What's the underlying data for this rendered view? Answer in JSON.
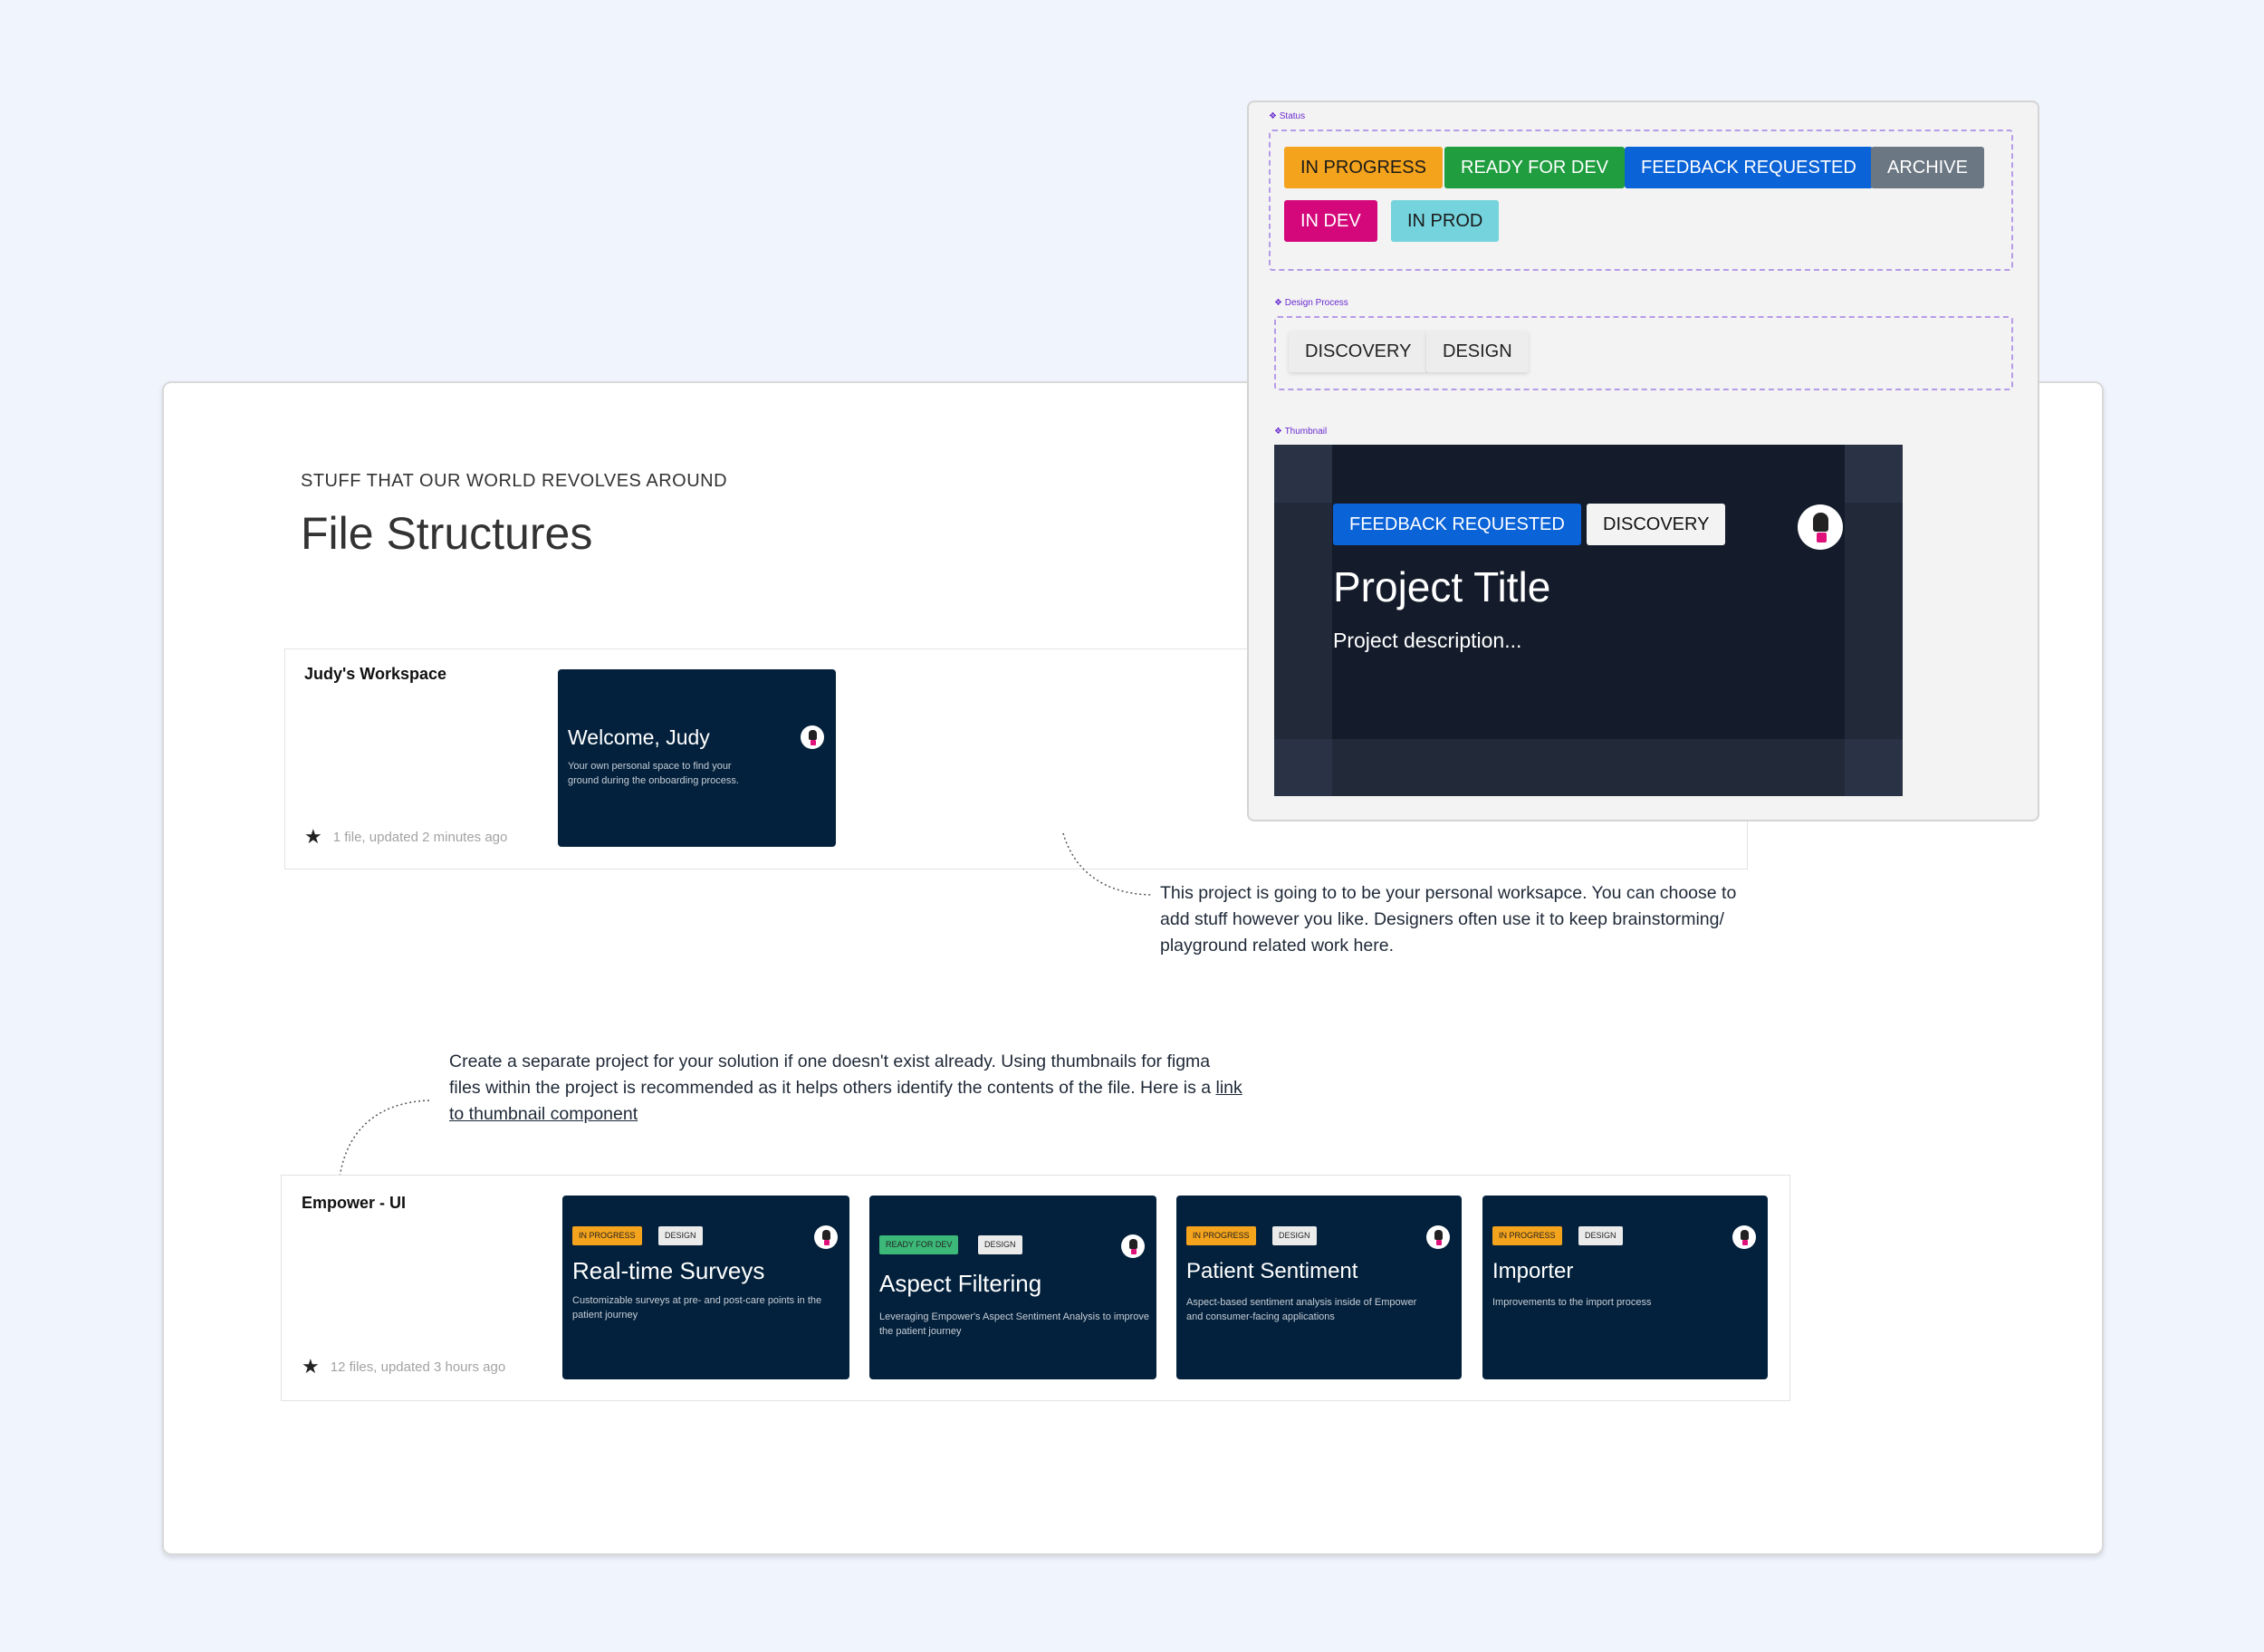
{
  "header": {
    "eyebrow": "STUFF THAT OUR WORLD REVOLVES AROUND",
    "title": "File Structures"
  },
  "workspace": {
    "name": "Judy's Workspace",
    "meta": "1 file, updated 2 minutes ago",
    "thumbnail": {
      "title": "Welcome, Judy",
      "description": "Your own personal space to find your ground during the onboarding process."
    }
  },
  "workspace_note": "This project is going to to be your personal worksapce. You can choose to add stuff however you like. Designers often use it to keep brainstorming/ playground related work here.",
  "solution_note": {
    "text": "Create a separate project for your solution if one doesn't exist already. Using thumbnails for figma files within the project is recommended as it helps others identify the contents of the file. Here is a",
    "link": "link to thumbnail component"
  },
  "project": {
    "name": "Empower - UI",
    "meta": "12 files, updated 3 hours ago",
    "files": [
      {
        "status": "IN PROGRESS",
        "status_color": "#f4a31c",
        "process": "DESIGN",
        "title": "Real-time Surveys",
        "description": "Customizable surveys at pre- and post-care points in the patient journey"
      },
      {
        "status": "READY FOR DEV",
        "status_color": "#3cb878",
        "process": "DESIGN",
        "title": "Aspect Filtering",
        "description": "Leveraging Empower's Aspect Sentiment Analysis to improve the patient journey"
      },
      {
        "status": "IN PROGRESS",
        "status_color": "#f4a31c",
        "process": "DESIGN",
        "title": "Patient Sentiment",
        "description": "Aspect-based sentiment analysis inside of Empower and consumer-facing applications"
      },
      {
        "status": "IN PROGRESS",
        "status_color": "#f4a31c",
        "process": "DESIGN",
        "title": "Importer",
        "description": "Improvements to the import process"
      }
    ]
  },
  "components": {
    "status_label": "❖ Status",
    "statuses": [
      {
        "label": "IN PROGRESS",
        "bg": "#f4a31c",
        "fg": "#1a1a1a"
      },
      {
        "label": "READY FOR DEV",
        "bg": "#1f9d3f",
        "fg": "#ffffff"
      },
      {
        "label": "FEEDBACK REQUESTED",
        "bg": "#0b63d8",
        "fg": "#ffffff"
      },
      {
        "label": "ARCHIVE",
        "bg": "#6b7782",
        "fg": "#ffffff"
      },
      {
        "label": "IN DEV",
        "bg": "#d4087a",
        "fg": "#ffffff"
      },
      {
        "label": "IN PROD",
        "bg": "#74d3dc",
        "fg": "#1a1a1a"
      }
    ],
    "process_label": "❖ Design Process",
    "process": [
      "DISCOVERY",
      "DESIGN"
    ],
    "thumbnail_label": "❖ Thumbnail",
    "thumbnail": {
      "status": "FEEDBACK REQUESTED",
      "process": "DISCOVERY",
      "title": "Project Title",
      "description": "Project description..."
    }
  }
}
